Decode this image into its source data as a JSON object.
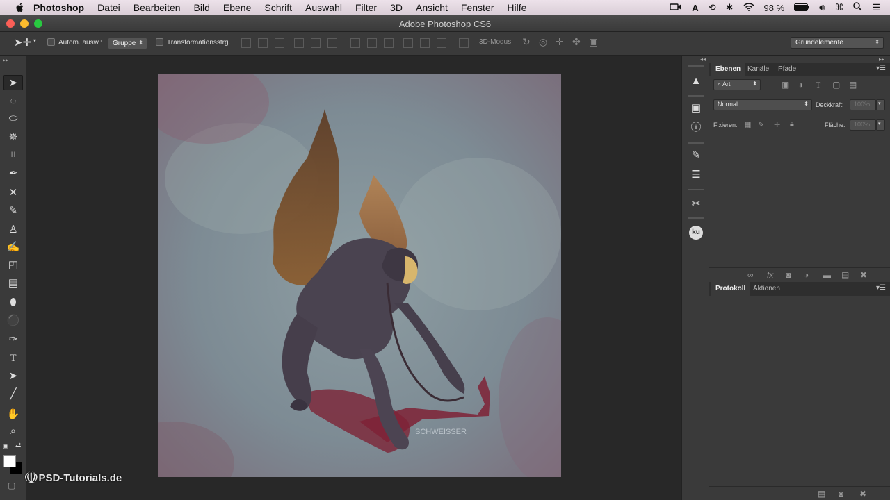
{
  "menubar": {
    "app_name": "Photoshop",
    "items": [
      "Datei",
      "Bearbeiten",
      "Bild",
      "Ebene",
      "Schrift",
      "Auswahl",
      "Filter",
      "3D",
      "Ansicht",
      "Fenster",
      "Hilfe"
    ],
    "battery": "98 %"
  },
  "window": {
    "title": "Adobe Photoshop CS6"
  },
  "options": {
    "auto_select_label": "Autom. ausw.:",
    "auto_select_value": "Gruppe",
    "transform_label": "Transformationsstrg.",
    "mode3d_label": "3D-Modus:",
    "workspace": "Grundelemente"
  },
  "layers_panel": {
    "tabs": [
      "Ebenen",
      "Kanäle",
      "Pfade"
    ],
    "filter_kind": "Art",
    "blend_mode": "Normal",
    "opacity_label": "Deckkraft:",
    "opacity_value": "100%",
    "lock_label": "Fixieren:",
    "fill_label": "Fläche:",
    "fill_value": "100%"
  },
  "history_panel": {
    "tabs": [
      "Protokoll",
      "Aktionen"
    ]
  },
  "dock": {
    "kuler_label": "ku"
  },
  "watermark": "PSD-Tutorials.de",
  "artwork": {
    "signature": "SCHWEISSER"
  },
  "colors": {
    "foreground": "#ffffff",
    "background": "#000000"
  }
}
